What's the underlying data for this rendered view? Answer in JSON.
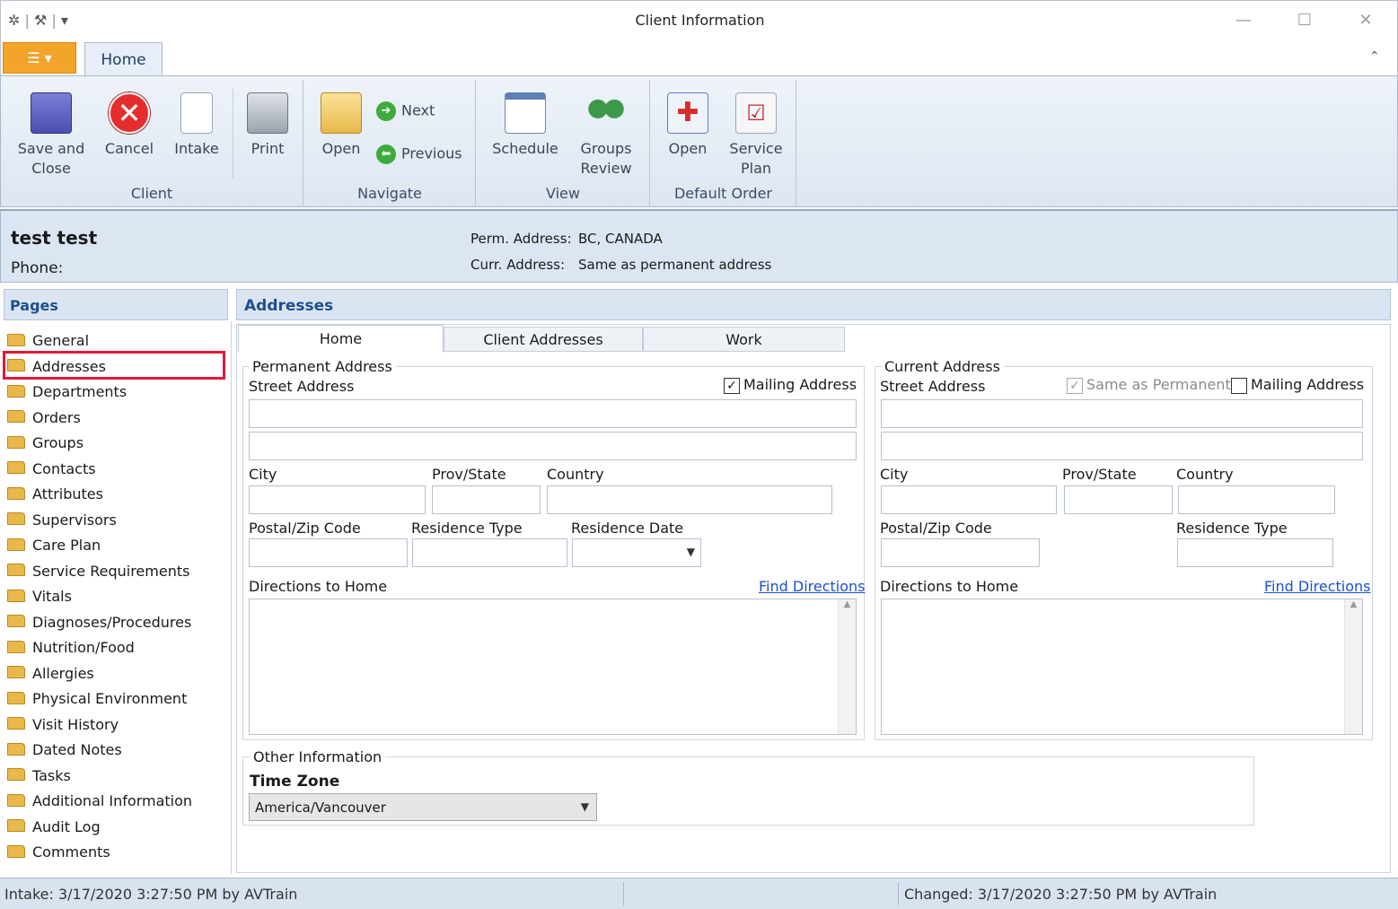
{
  "window": {
    "title": "Client Information",
    "app_button": "☰ ▾",
    "minimize": "—",
    "maximize": "☐",
    "close": "✕"
  },
  "quick_access": {
    "icons": [
      "gear-icon",
      "tools-icon",
      "dropdown-icon"
    ]
  },
  "ribbon": {
    "tab": "Home",
    "groups": {
      "client": {
        "label": "Client",
        "save_close": "Save and Close",
        "cancel": "Cancel",
        "intake": "Intake",
        "print": "Print"
      },
      "navigate": {
        "label": "Navigate",
        "open": "Open",
        "next": "Next",
        "previous": "Previous"
      },
      "view": {
        "label": "View",
        "schedule": "Schedule",
        "groups_review": "Groups Review"
      },
      "default_order": {
        "label": "Default Order",
        "open": "Open",
        "service_plan": "Service Plan"
      }
    }
  },
  "client": {
    "name": "test test",
    "phone_label": "Phone:",
    "perm_label": "Perm. Address:",
    "perm_value": "BC, CANADA",
    "curr_label": "Curr. Address:",
    "curr_value": "Same as permanent address"
  },
  "pages": {
    "title": "Pages",
    "items": [
      "General",
      "Addresses",
      "Departments",
      "Orders",
      "Groups",
      "Contacts",
      "Attributes",
      "Supervisors",
      "Care Plan",
      "Service Requirements",
      "Vitals",
      "Diagnoses/Procedures",
      "Nutrition/Food",
      "Allergies",
      "Physical Environment",
      "Visit History",
      "Dated Notes",
      "Tasks",
      "Additional Information",
      "Audit Log",
      "Comments"
    ],
    "selected": "Addresses"
  },
  "content": {
    "title": "Addresses",
    "tabs": [
      "Home",
      "Client Addresses",
      "Work"
    ],
    "active_tab": "Home",
    "permanent": {
      "legend": "Permanent Address",
      "street": "Street Address",
      "mailing": "Mailing Address",
      "mailing_checked": true,
      "city": "City",
      "prov": "Prov/State",
      "country": "Country",
      "postal": "Postal/Zip Code",
      "res_type": "Residence Type",
      "res_date": "Residence Date",
      "directions": "Directions to Home",
      "find": "Find Directions"
    },
    "current": {
      "legend": "Current Address",
      "street": "Street Address",
      "same": "Same as Permanent",
      "same_checked": true,
      "mailing": "Mailing Address",
      "mailing_checked": false,
      "city": "City",
      "prov": "Prov/State",
      "country": "Country",
      "postal": "Postal/Zip Code",
      "res_type": "Residence Type",
      "directions": "Directions to Home",
      "find": "Find Directions"
    },
    "other": {
      "legend": "Other Information",
      "tz_label": "Time Zone",
      "tz_value": "America/Vancouver"
    }
  },
  "status": {
    "intake": "Intake: 3/17/2020 3:27:50 PM by AVTrain",
    "changed": "Changed: 3/17/2020 3:27:50 PM by AVTrain"
  }
}
